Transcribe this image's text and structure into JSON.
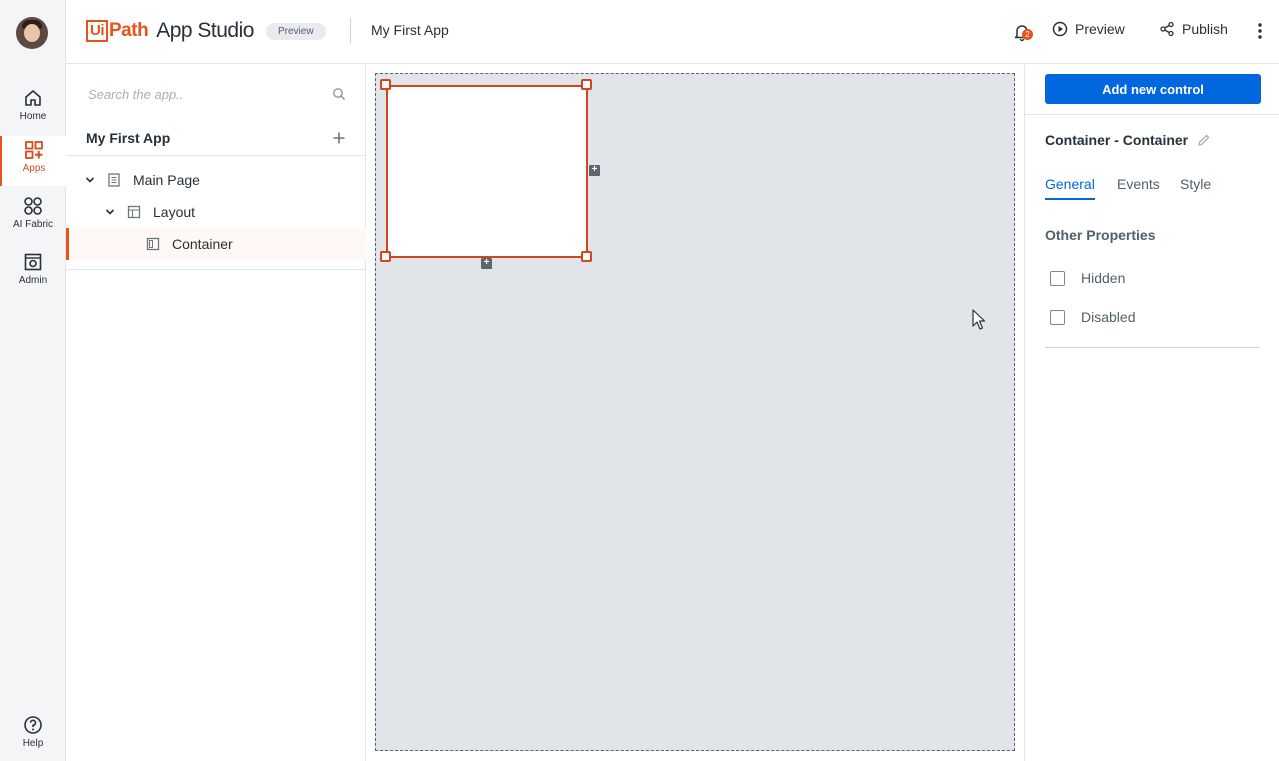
{
  "rail": {
    "items": [
      {
        "label": "Home",
        "icon": "home-icon"
      },
      {
        "label": "Apps",
        "icon": "apps-icon",
        "active": true
      },
      {
        "label": "AI Fabric",
        "icon": "ai-fabric-icon"
      },
      {
        "label": "Admin",
        "icon": "admin-icon"
      },
      {
        "label": "Help",
        "icon": "help-icon"
      }
    ]
  },
  "header": {
    "logo_ui": "Ui",
    "logo_path": "Path",
    "product": "App Studio",
    "badge": "Preview",
    "app_name": "My First App",
    "notification_count": "2",
    "preview_label": "Preview",
    "publish_label": "Publish"
  },
  "tree": {
    "search_placeholder": "Search the app..",
    "title": "My First App",
    "nodes": [
      {
        "label": "Main Page",
        "icon": "page-icon",
        "level": 0,
        "expanded": true
      },
      {
        "label": "Layout",
        "icon": "layout-icon",
        "level": 1,
        "expanded": true
      },
      {
        "label": "Container",
        "icon": "container-icon",
        "level": 2,
        "selected": true
      }
    ]
  },
  "props": {
    "add_control_label": "Add new control",
    "component_title": "Container - Container",
    "tabs": [
      {
        "label": "General",
        "active": true
      },
      {
        "label": "Events"
      },
      {
        "label": "Style"
      }
    ],
    "section_title": "Other Properties",
    "checkboxes": [
      {
        "label": "Hidden",
        "checked": false
      },
      {
        "label": "Disabled",
        "checked": false
      }
    ]
  },
  "colors": {
    "brand_orange": "#e8521c",
    "accent_blue": "#0067df",
    "canvas_bg": "#e1e4e8"
  }
}
